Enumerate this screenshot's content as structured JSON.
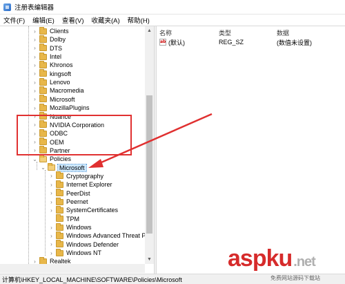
{
  "window": {
    "title": "注册表编辑器",
    "icon": "registry-icon"
  },
  "menu": [
    "文件(F)",
    "编辑(E)",
    "查看(V)",
    "收藏夹(A)",
    "帮助(H)"
  ],
  "tree": {
    "items": [
      {
        "label": "Clients",
        "toggle": ">"
      },
      {
        "label": "Dolby",
        "toggle": ">"
      },
      {
        "label": "DTS",
        "toggle": ">"
      },
      {
        "label": "Intel",
        "toggle": ">"
      },
      {
        "label": "Khronos",
        "toggle": ">"
      },
      {
        "label": "kingsoft",
        "toggle": ">"
      },
      {
        "label": "Lenovo",
        "toggle": ">"
      },
      {
        "label": "Macromedia",
        "toggle": ">"
      },
      {
        "label": "Microsoft",
        "toggle": ">"
      },
      {
        "label": "MozillaPlugins",
        "toggle": ">"
      },
      {
        "label": "Nuance",
        "toggle": ">"
      },
      {
        "label": "NVIDIA Corporation",
        "toggle": ">"
      },
      {
        "label": "ODBC",
        "toggle": ">"
      },
      {
        "label": "OEM",
        "toggle": ">"
      },
      {
        "label": "Partner",
        "toggle": ">"
      },
      {
        "label": "Policies",
        "toggle": "v"
      },
      {
        "label": "Microsoft",
        "toggle": "v",
        "selected": true
      },
      {
        "label": "Cryptography",
        "toggle": ">"
      },
      {
        "label": "Internet Explorer",
        "toggle": ">"
      },
      {
        "label": "PeerDist",
        "toggle": ">"
      },
      {
        "label": "Peernet",
        "toggle": ">"
      },
      {
        "label": "SystemCertificates",
        "toggle": ">"
      },
      {
        "label": "TPM",
        "toggle": ""
      },
      {
        "label": "Windows",
        "toggle": ">"
      },
      {
        "label": "Windows Advanced Threat P",
        "toggle": ">"
      },
      {
        "label": "Windows Defender",
        "toggle": ">"
      },
      {
        "label": "Windows NT",
        "toggle": ">"
      },
      {
        "label": "Realtek",
        "toggle": ">"
      }
    ]
  },
  "list": {
    "headers": {
      "name": "名称",
      "type": "类型",
      "data": "数据"
    },
    "rows": [
      {
        "name": "(默认)",
        "type": "REG_SZ",
        "data": "(数值未设置)",
        "icon": "ab-string-icon"
      }
    ]
  },
  "status": {
    "path": "计算机\\HKEY_LOCAL_MACHINE\\SOFTWARE\\Policies\\Microsoft"
  },
  "watermark": {
    "main": "aspku",
    "suffix": ".net",
    "sub": "免费网站源码下载站"
  },
  "colors": {
    "selection": "#cce8ff",
    "annotation": "#e03030",
    "watermark": "#d62b2b"
  }
}
